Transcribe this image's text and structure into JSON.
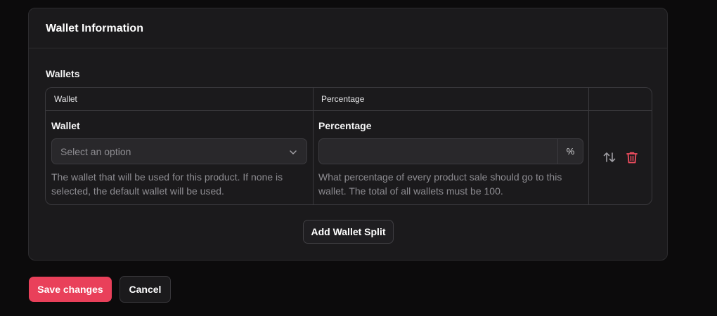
{
  "card": {
    "title": "Wallet Information",
    "section_label": "Wallets"
  },
  "table": {
    "headers": [
      "Wallet",
      "Percentage",
      ""
    ],
    "row": {
      "wallet_label": "Wallet",
      "wallet_placeholder": "Select an option",
      "wallet_help": "The wallet that will be used for this product. If none is selected, the default wallet will be used.",
      "percentage_label": "Percentage",
      "percentage_value": "",
      "percentage_suffix": "%",
      "percentage_help": "What percentage of every product sale should go to this wallet. The total of all wallets must be 100.",
      "reorder_icon": "arrows-up-down-icon",
      "delete_icon": "trash-icon"
    }
  },
  "actions": {
    "add_wallet_split": "Add Wallet Split",
    "save": "Save changes",
    "cancel": "Cancel"
  },
  "colors": {
    "background": "#0c0b0c",
    "card": "#1b1a1c",
    "primary": "#e9405a",
    "danger_icon": "#ef4d5f"
  }
}
